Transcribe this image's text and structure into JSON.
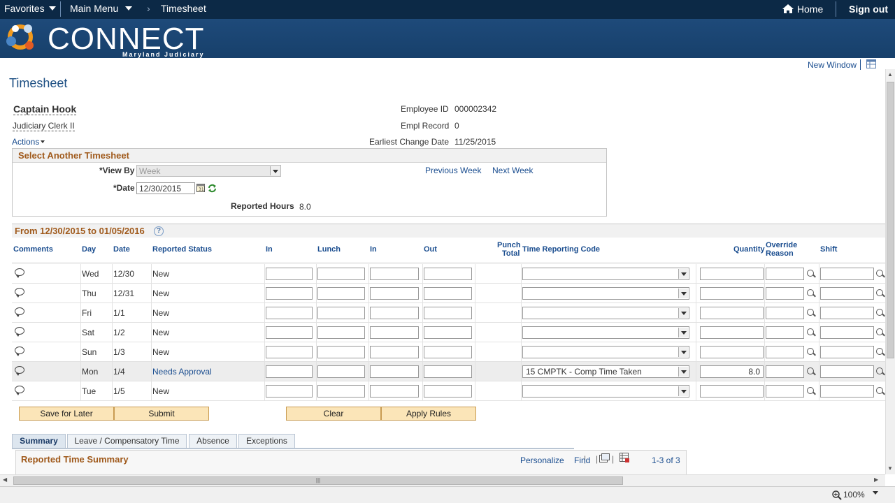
{
  "topbar": {
    "favorites": "Favorites",
    "main_menu": "Main Menu",
    "breadcrumb": "Timesheet",
    "home": "Home",
    "sign_out": "Sign out"
  },
  "banner": {
    "logo": "CONNECT",
    "sub": "Maryland Judiciary"
  },
  "toolbar": {
    "new_window": "New Window"
  },
  "page_title": "Timesheet",
  "employee": {
    "name": "Captain Hook",
    "title": "Judiciary Clerk II",
    "actions": "Actions",
    "id_label": "Employee ID",
    "id_value": "000002342",
    "record_label": "Empl Record",
    "record_value": "0",
    "change_label": "Earliest Change Date",
    "change_value": "11/25/2015"
  },
  "select_timesheet": {
    "header": "Select Another Timesheet",
    "view_by_label": "*View By",
    "view_by_value": "Week",
    "date_label": "*Date",
    "date_value": "12/30/2015",
    "prev_week": "Previous Week",
    "next_week": "Next Week",
    "reported_hours_label": "Reported Hours",
    "reported_hours_value": "8.0"
  },
  "period": {
    "header": "From 12/30/2015 to 01/05/2016"
  },
  "grid": {
    "headers": {
      "comments": "Comments",
      "day": "Day",
      "date": "Date",
      "status": "Reported Status",
      "in1": "In",
      "lunch": "Lunch",
      "in2": "In",
      "out": "Out",
      "punch1": "Punch",
      "punch2": "Total",
      "trc": "Time Reporting Code",
      "qty": "Quantity",
      "override1": "Override",
      "override2": "Reason",
      "shift": "Shift"
    },
    "rows": [
      {
        "day": "Wed",
        "date": "12/30",
        "status": "New",
        "trc": "",
        "qty": ""
      },
      {
        "day": "Thu",
        "date": "12/31",
        "status": "New",
        "trc": "",
        "qty": ""
      },
      {
        "day": "Fri",
        "date": "1/1",
        "status": "New",
        "trc": "",
        "qty": ""
      },
      {
        "day": "Sat",
        "date": "1/2",
        "status": "New",
        "trc": "",
        "qty": ""
      },
      {
        "day": "Sun",
        "date": "1/3",
        "status": "New",
        "trc": "",
        "qty": ""
      },
      {
        "day": "Mon",
        "date": "1/4",
        "status": "Needs Approval",
        "trc": "15 CMPTK - Comp Time Taken",
        "qty": "8.0"
      },
      {
        "day": "Tue",
        "date": "1/5",
        "status": "New",
        "trc": "",
        "qty": ""
      }
    ]
  },
  "buttons": {
    "save": "Save for Later",
    "submit": "Submit",
    "clear": "Clear",
    "apply": "Apply Rules"
  },
  "tabs": [
    "Summary",
    "Leave / Compensatory Time",
    "Absence",
    "Exceptions"
  ],
  "summary": {
    "header": "Reported Time Summary",
    "personalize": "Personalize",
    "find": "Find",
    "count": "1-3 of 3"
  },
  "statusbar": {
    "zoom": "100%"
  }
}
